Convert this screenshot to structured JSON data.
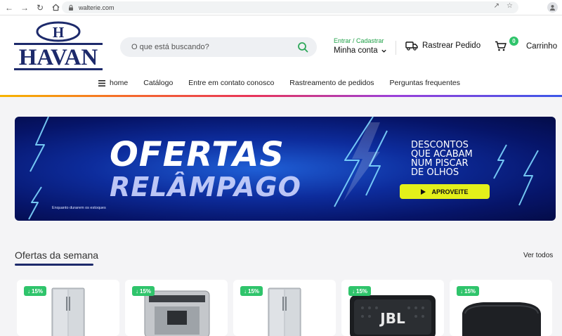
{
  "browser": {
    "url": "walterie.com"
  },
  "header": {
    "logo_text": "HAVAN",
    "search_placeholder": "O que está buscando?",
    "account_small": "Entrar / Cadastrar",
    "account_big": "Minha conta",
    "track_label": "Rastrear Pedido",
    "cart_label": "Carrinho",
    "cart_count": "0"
  },
  "menu": {
    "items": [
      "home",
      "Catálogo",
      "Entre em contato conosco",
      "Rastreamento de pedidos",
      "Perguntas frequentes"
    ]
  },
  "banner": {
    "line1": "OFERTAS",
    "line2": "RELÂMPAGO",
    "desc_lines": [
      "DESCONTOS",
      "QUE ACABAM",
      "NUM PISCAR",
      "DE OLHOS"
    ],
    "cta": "APROVEITE",
    "fine_print": "Enquanto durarem os estoques"
  },
  "section": {
    "title": "Ofertas da semana",
    "see_all": "Ver todos"
  },
  "products": [
    {
      "discount": "15%",
      "kind": "refrigerator"
    },
    {
      "discount": "15%",
      "kind": "dispenser"
    },
    {
      "discount": "15%",
      "kind": "refrigerator"
    },
    {
      "discount": "15%",
      "kind": "speaker",
      "brand": "JBL"
    },
    {
      "discount": "15%",
      "kind": "speaker-round"
    }
  ],
  "colors": {
    "brand_navy": "#1d2a6b",
    "accent_green": "#2fc46b",
    "cta_yellow": "#e3f01a"
  }
}
